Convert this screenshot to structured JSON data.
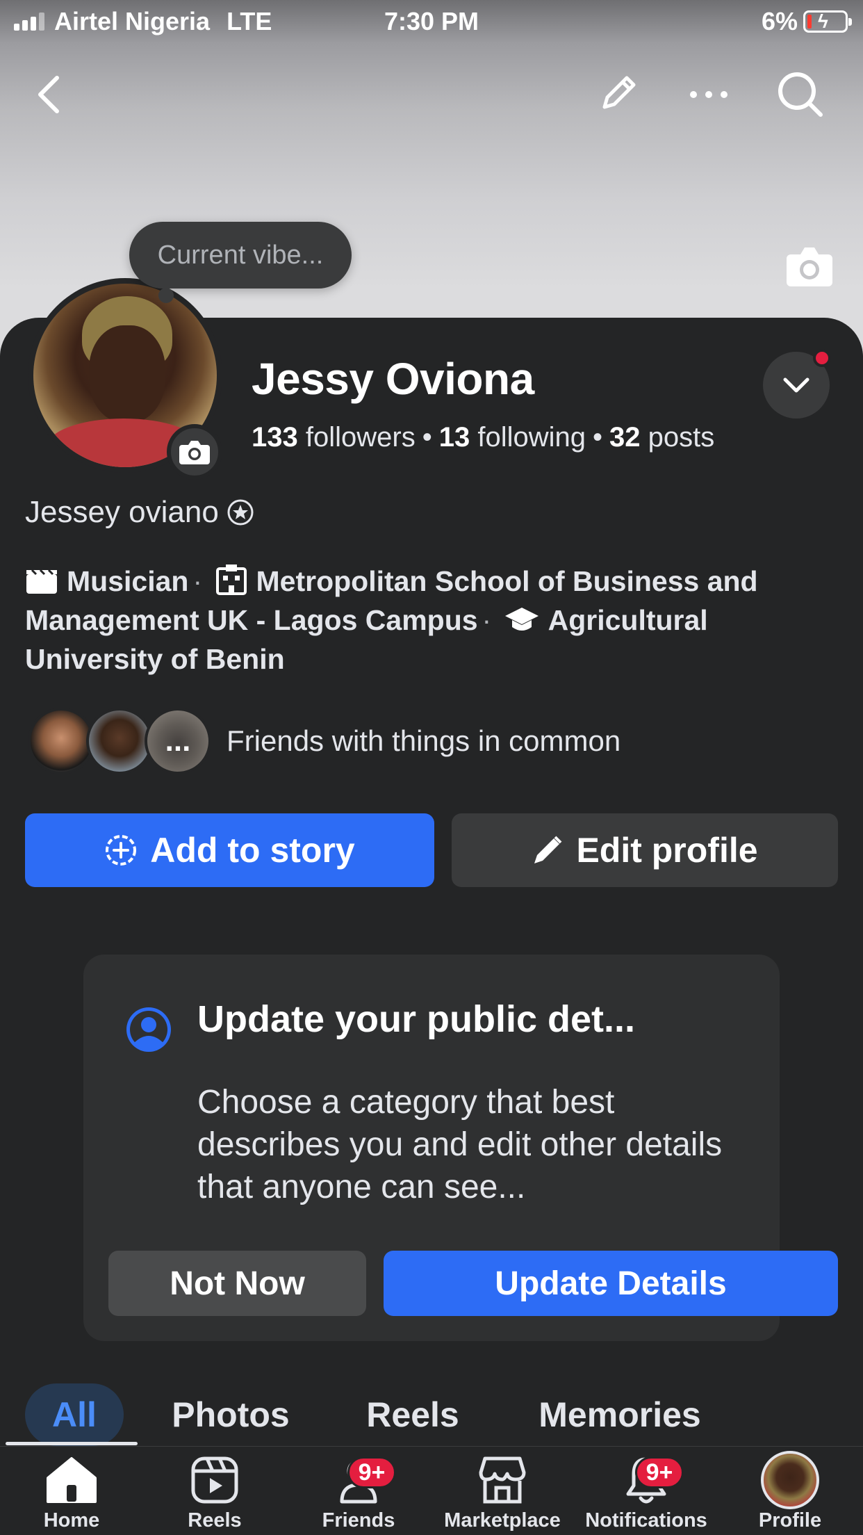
{
  "status_bar": {
    "carrier": "Airtel Nigeria",
    "network": "LTE",
    "time": "7:30 PM",
    "battery": "6%"
  },
  "top_nav": {
    "icons": [
      "back-icon",
      "edit-pencil-icon",
      "more-options-icon",
      "search-icon"
    ]
  },
  "profile": {
    "vibe_placeholder": "Current vibe...",
    "name": "Jessy Oviona",
    "followers_count": "133",
    "followers_label": "followers",
    "following_count": "13",
    "following_label": "following",
    "posts_count": "32",
    "posts_label": "posts",
    "alt_name": "Jessey oviano",
    "occupation": "Musician",
    "school": "Metropolitan School of Business and Management UK - Lagos Campus",
    "university": "Agricultural University of Benin",
    "friends_text": "Friends with things in common",
    "friends_more": "..."
  },
  "actions": {
    "add_story": "Add to story",
    "edit_profile": "Edit profile"
  },
  "card": {
    "title": "Update your public det...",
    "body": "Choose a category that best describes you and edit other details that anyone can see...",
    "not_now": "Not Now",
    "update": "Update Details"
  },
  "tabs": [
    "All",
    "Photos",
    "Reels",
    "Memories"
  ],
  "bottom_nav": {
    "home": "Home",
    "reels": "Reels",
    "friends": "Friends",
    "friends_badge": "9+",
    "marketplace": "Marketplace",
    "notifications": "Notifications",
    "notifications_badge": "9+",
    "profile": "Profile"
  },
  "colors": {
    "background": "#242526",
    "accent": "#2d6cf5",
    "badge": "#e41e3f"
  }
}
